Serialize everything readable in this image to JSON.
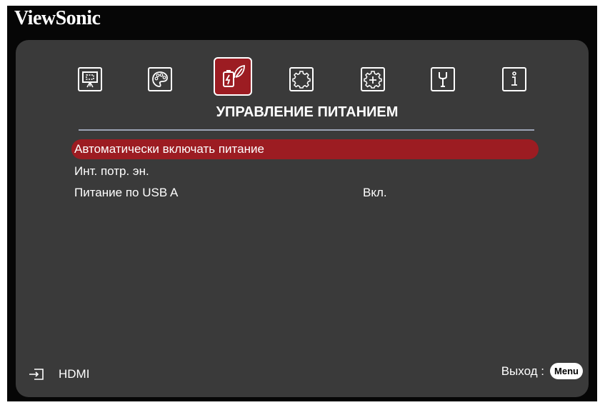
{
  "brand": "ViewSonic",
  "tabs": [
    {
      "icon": "screen-icon",
      "selected": false
    },
    {
      "icon": "palette-icon",
      "selected": false
    },
    {
      "icon": "power-leaf-icon",
      "selected": true
    },
    {
      "icon": "gear-icon",
      "selected": false
    },
    {
      "icon": "gear-plus-icon",
      "selected": false
    },
    {
      "icon": "wrench-icon",
      "selected": false
    },
    {
      "icon": "info-icon",
      "selected": false
    }
  ],
  "section_title": "УПРАВЛЕНИЕ ПИТАНИЕМ",
  "menu": [
    {
      "label": "Автоматически включать питание",
      "value": ""
    },
    {
      "label": "Инт. потр. эн.",
      "value": ""
    },
    {
      "label": "Питание по USB A",
      "value": "Вкл."
    }
  ],
  "footer": {
    "source_label": "HDMI",
    "exit_label": "Выход :",
    "menu_key": "Menu"
  },
  "colors": {
    "highlight": "#9c1c22",
    "panel": "#3a3a3a",
    "background": "#060606",
    "divider": "#9ca3b6"
  }
}
